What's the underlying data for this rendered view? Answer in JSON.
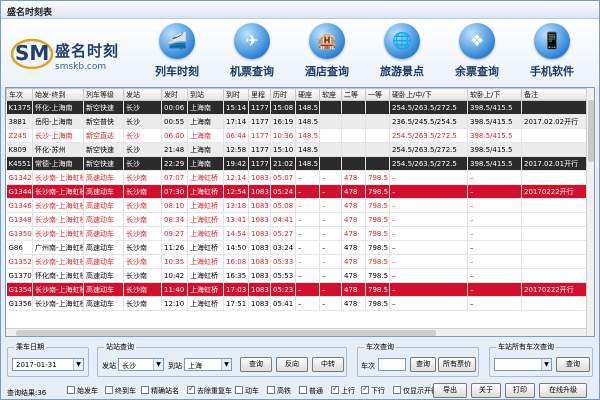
{
  "window": {
    "title": "盛名时刻表"
  },
  "logo": {
    "mark": "SM",
    "brand": "盛名时刻",
    "site": "smskb.com"
  },
  "nav": [
    {
      "label": "列车时刻",
      "icon": "train-icon",
      "glyph": "🚄"
    },
    {
      "label": "机票查询",
      "icon": "airplane-icon",
      "glyph": "✈"
    },
    {
      "label": "酒店查询",
      "icon": "hotel-icon",
      "glyph": "🏨"
    },
    {
      "label": "旅游景点",
      "icon": "globe-icon",
      "glyph": "🌐"
    },
    {
      "label": "余票查询",
      "icon": "windows-icon",
      "glyph": "❖"
    },
    {
      "label": "手机软件",
      "icon": "phone-icon",
      "glyph": "📱"
    }
  ],
  "table": {
    "headers": [
      "车次",
      "始发-终到",
      "列车等级",
      "发站",
      "发时",
      "到站",
      "到时",
      "里程",
      "历时",
      "硬座",
      "软座",
      "二等",
      "一等",
      "硬卧上/中/下",
      "软卧上/下",
      "备注"
    ],
    "rows": [
      {
        "style": "dark",
        "cells": [
          "K1375",
          "怀化-上海南",
          "新空快速",
          "长沙",
          "00:06",
          "上海南",
          "15:14",
          "1177",
          "15:08",
          "148.5",
          "",
          "",
          "",
          "254.5/263.5/272.5",
          "398.5/415.5",
          ""
        ]
      },
      {
        "style": "shade",
        "cells": [
          "3881",
          "岳阳-上海南",
          "新空普快",
          "长沙",
          "00:55",
          "上海南",
          "17:14",
          "1177",
          "16:19",
          "148.5",
          "",
          "",
          "",
          "236.5/245.5/254.5",
          "398.5/415.5",
          "2017.02.02开行"
        ]
      },
      {
        "style": "red",
        "cells": [
          "Z245",
          "长沙-上海南",
          "新空直达",
          "长沙",
          "06:00",
          "上海南",
          "06:44",
          "1177",
          "10:36",
          "148.5",
          "",
          "",
          "",
          "254.5/263.5/272.5",
          "398.5/415.5",
          ""
        ]
      },
      {
        "style": "shade",
        "cells": [
          "K809",
          "怀化-苏州",
          "新空快速",
          "长沙",
          "21:48",
          "上海南",
          "12:58",
          "1177",
          "15:10",
          "148.5",
          "",
          "",
          "",
          "254.5/263.5/272.5",
          "398.5/415.5",
          ""
        ]
      },
      {
        "style": "dark",
        "cells": [
          "K4551",
          "常德-上海南",
          "新空快速",
          "长沙",
          "22:29",
          "上海南",
          "19:42",
          "1177",
          "21:02",
          "148.5",
          "",
          "",
          "",
          "254.5/263.5/272.5",
          "398.5/415.5",
          "2017.02.01开行"
        ]
      },
      {
        "style": "red",
        "cells": [
          "G1342",
          "长沙南-上海虹桥",
          "高速动车",
          "长沙南",
          "07:07",
          "上海虹桥",
          "12:14",
          "1083",
          "05:07",
          "–",
          "–",
          "478",
          "798.5",
          "–",
          "–",
          ""
        ]
      },
      {
        "style": "sel",
        "cells": [
          "G1344",
          "长沙南-上海虹桥",
          "高速动车",
          "长沙南",
          "07:30",
          "上海虹桥",
          "12:54",
          "1083",
          "05:24",
          "–",
          "–",
          "478",
          "798.5",
          "–",
          "–",
          "20170222开行"
        ]
      },
      {
        "style": "red",
        "cells": [
          "G1346",
          "长沙南-上海虹桥",
          "高速动车",
          "长沙南",
          "08:10",
          "上海虹桥",
          "13:18",
          "1083",
          "05:08",
          "–",
          "–",
          "478",
          "798.5",
          "–",
          "–",
          ""
        ]
      },
      {
        "style": "red",
        "cells": [
          "G1348",
          "长沙南-上海虹桥",
          "高速动车",
          "长沙南",
          "08:34",
          "上海虹桥",
          "13:41",
          "1083",
          "04:41",
          "–",
          "–",
          "478",
          "798.5",
          "–",
          "–",
          ""
        ]
      },
      {
        "style": "red",
        "cells": [
          "G1350",
          "长沙南-上海虹桥",
          "高速动车",
          "长沙南",
          "09:27",
          "上海虹桥",
          "14:54",
          "1083",
          "05:27",
          "–",
          "–",
          "478",
          "798.5",
          "–",
          "–",
          ""
        ]
      },
      {
        "style": "plain",
        "cells": [
          "G86",
          "广州南-上海虹桥",
          "高速动车",
          "长沙南",
          "11:26",
          "上海虹桥",
          "14:50",
          "1083",
          "03:24",
          "–",
          "–",
          "478",
          "798.5",
          "–",
          "–",
          ""
        ]
      },
      {
        "style": "red",
        "cells": [
          "G1352",
          "长沙南-上海虹桥",
          "高速动车",
          "长沙南",
          "10:35",
          "上海虹桥",
          "16:08",
          "1083",
          "05:33",
          "–",
          "–",
          "478",
          "798.5",
          "–",
          "–",
          ""
        ]
      },
      {
        "style": "plain",
        "cells": [
          "G1370",
          "怀化南-上海虹桥",
          "高速动车",
          "长沙南",
          "10:42",
          "上海虹桥",
          "16:35",
          "1083",
          "05:53",
          "–",
          "–",
          "478",
          "798.5",
          "–",
          "–",
          ""
        ]
      },
      {
        "style": "sel",
        "cells": [
          "G1354",
          "长沙南-上海虹桥",
          "高速动车",
          "长沙南",
          "11:40",
          "上海虹桥",
          "17:03",
          "1083",
          "05:23",
          "–",
          "–",
          "478",
          "798.5",
          "–",
          "–",
          "20170222开行"
        ]
      },
      {
        "style": "plain",
        "cells": [
          "G1356",
          "长沙南-上海虹桥",
          "高速动车",
          "长沙南",
          "12:10",
          "上海虹桥",
          "17:51",
          "1083",
          "05:41",
          "–",
          "–",
          "478",
          "798.5",
          "–",
          "–",
          ""
        ]
      }
    ]
  },
  "date_group": {
    "title": "乘车日期",
    "value": "2017-01-31"
  },
  "station_group": {
    "title": "站站查询",
    "from_label": "发站",
    "from_value": "长沙",
    "to_label": "到站",
    "to_value": "上海",
    "query": "查询",
    "reverse": "反向",
    "transfer": "中转"
  },
  "train_group": {
    "title": "车次查询",
    "label": "车次",
    "query": "查询",
    "all_prices": "所有票价"
  },
  "station_all": {
    "title": "车站所有车次查询",
    "query": "查询"
  },
  "bottom": {
    "result": "查询结果:36",
    "checks": [
      {
        "label": "始发车",
        "on": false
      },
      {
        "label": "终到车",
        "on": false
      },
      {
        "label": "精确站名",
        "on": false
      },
      {
        "label": "去除重复车",
        "on": true
      },
      {
        "label": "动车",
        "on": false
      },
      {
        "label": "高铁",
        "on": false
      },
      {
        "label": "普通",
        "on": false
      },
      {
        "label": "上行",
        "on": true
      },
      {
        "label": "下行",
        "on": true
      },
      {
        "label": "仅显示开行",
        "on": false
      }
    ],
    "export": "导出",
    "about": "关于",
    "print": "打印",
    "upgrade": "在线升级"
  }
}
